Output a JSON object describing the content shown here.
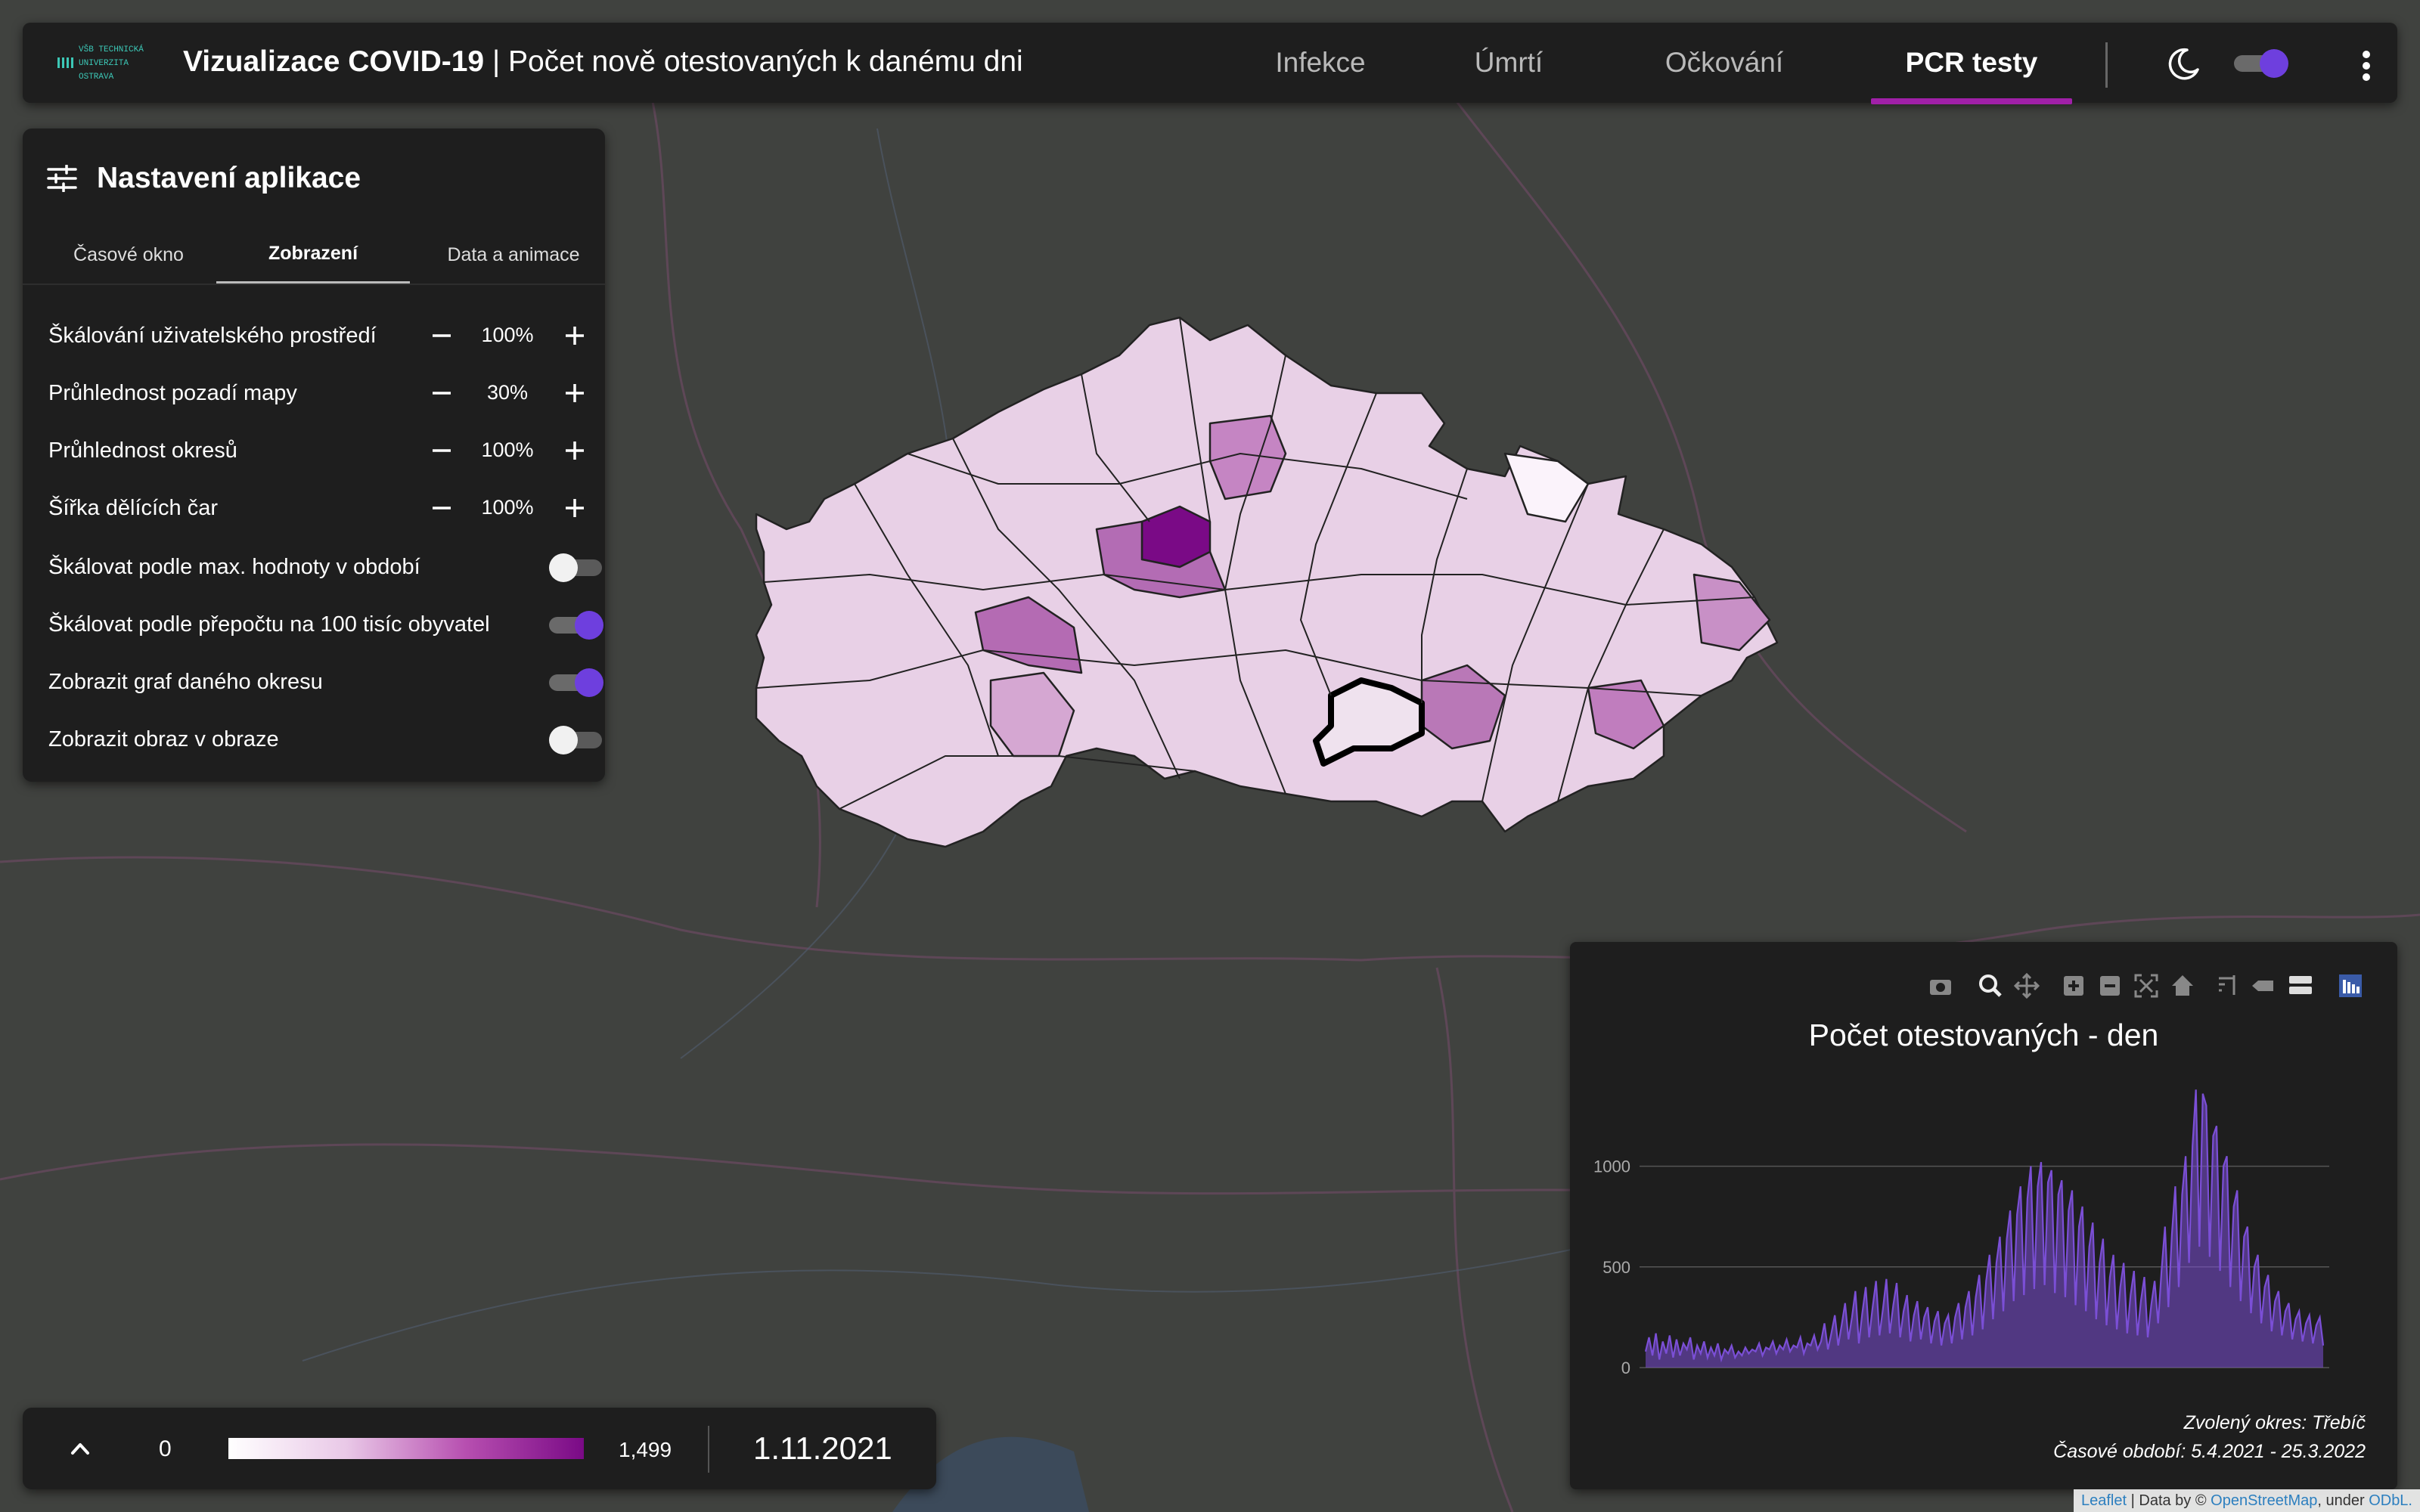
{
  "header": {
    "logo_lines": [
      "VŠB TECHNICKÁ",
      "|||| UNIVERZITA",
      "OSTRAVA"
    ],
    "app_name": "Vizualizace COVID-19",
    "separator": " | ",
    "subtitle": "Počet nově otestovaných k danému dni",
    "nav": [
      {
        "label": "Infekce",
        "active": false
      },
      {
        "label": "Úmrtí",
        "active": false
      },
      {
        "label": "Očkování",
        "active": false
      },
      {
        "label": "PCR testy",
        "active": true
      }
    ],
    "dark_mode_on": true
  },
  "settings": {
    "title": "Nastavení aplikace",
    "tabs": [
      {
        "label": "Časové okno",
        "active": false
      },
      {
        "label": "Zobrazení",
        "active": true
      },
      {
        "label": "Data a animace",
        "active": false
      }
    ],
    "steppers": [
      {
        "label": "Škálování uživatelského prostředí",
        "value": "100%"
      },
      {
        "label": "Průhlednost pozadí mapy",
        "value": "30%"
      },
      {
        "label": "Průhlednost okresů",
        "value": "100%"
      },
      {
        "label": "Šířka dělících čar",
        "value": "100%"
      }
    ],
    "toggles": [
      {
        "label": "Škálovat podle max. hodnoty v období",
        "on": false
      },
      {
        "label": "Škálovat podle přepočtu na 100 tisíc obyvatel",
        "on": true
      },
      {
        "label": "Zobrazit graf daného okresu",
        "on": true
      },
      {
        "label": "Zobrazit obraz v obraze",
        "on": false
      }
    ]
  },
  "legend": {
    "min": "0",
    "max": "1,499",
    "date": "1.11.2021"
  },
  "chart": {
    "title": "Počet otestovaných - den",
    "footer_district": "Zvolený okres: Třebíč",
    "footer_period": "Časové období: 5.4.2021 - 25.3.2022",
    "toolbar_icons": [
      "camera-icon",
      "zoom-icon",
      "pan-icon",
      "zoom-in-icon",
      "zoom-out-icon",
      "autoscale-icon",
      "home-icon",
      "spike-lines-icon",
      "compare-hover-icon",
      "closest-hover-icon",
      "plotly-logo-icon"
    ]
  },
  "chart_data": {
    "type": "area",
    "title": "Počet otestovaných - den",
    "ylim": [
      0,
      1400
    ],
    "yticks": [
      0,
      500,
      1000
    ],
    "grid": true,
    "color": "#7b4fd6",
    "series": [
      {
        "name": "",
        "values": [
          80,
          150,
          60,
          170,
          40,
          130,
          70,
          160,
          50,
          140,
          60,
          120,
          90,
          150,
          40,
          110,
          70,
          130,
          50,
          100,
          60,
          120,
          40,
          90,
          70,
          110,
          50,
          80,
          60,
          100,
          70,
          90,
          80,
          120,
          60,
          100,
          90,
          130,
          70,
          110,
          90,
          140,
          80,
          110,
          100,
          150,
          70,
          120,
          110,
          160,
          90,
          130,
          220,
          90,
          170,
          260,
          110,
          210,
          320,
          140,
          250,
          380,
          120,
          270,
          400,
          150,
          300,
          430,
          160,
          290,
          440,
          170,
          310,
          420,
          150,
          280,
          360,
          130,
          260,
          330,
          140,
          250,
          300,
          120,
          230,
          280,
          110,
          220,
          260,
          120,
          250,
          320,
          140,
          300,
          380,
          160,
          350,
          460,
          190,
          430,
          560,
          240,
          520,
          650,
          280,
          640,
          780,
          330,
          760,
          900,
          360,
          840,
          1000,
          390,
          900,
          1020,
          410,
          920,
          980,
          370,
          860,
          930,
          350,
          780,
          880,
          310,
          700,
          800,
          280,
          600,
          720,
          240,
          520,
          640,
          210,
          450,
          560,
          190,
          400,
          520,
          170,
          360,
          480,
          160,
          330,
          450,
          150,
          310,
          430,
          220,
          480,
          700,
          300,
          660,
          900,
          400,
          860,
          1050,
          520,
          1100,
          1380,
          600,
          1360,
          1300,
          550,
          1150,
          1200,
          480,
          1000,
          1050,
          400,
          800,
          880,
          330,
          650,
          700,
          270,
          500,
          560,
          220,
          400,
          460,
          180,
          330,
          380,
          160,
          280,
          320,
          140,
          240,
          280,
          130,
          220,
          260,
          120,
          210,
          250,
          110
        ]
      }
    ]
  },
  "attribution": {
    "leaflet": "Leaflet",
    "data_by": " | Data by © ",
    "osm": "OpenStreetMap",
    "under": ", under ",
    "odbl": "ODbL."
  }
}
